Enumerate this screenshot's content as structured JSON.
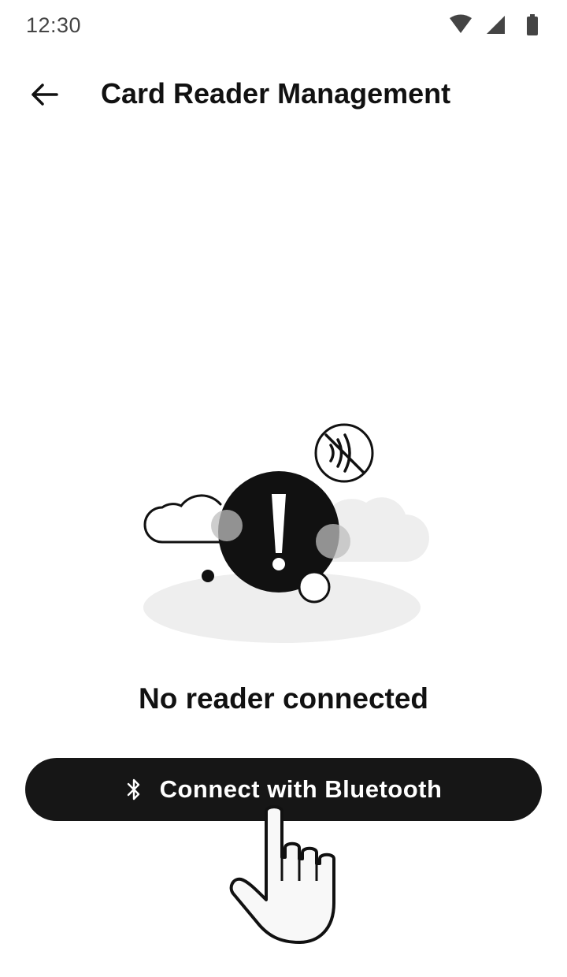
{
  "status_bar": {
    "time": "12:30",
    "icons": [
      "wifi-icon",
      "cellular-signal-icon",
      "battery-icon"
    ]
  },
  "app_bar": {
    "title": "Card Reader Management",
    "back_icon": "arrow-left-icon"
  },
  "illustration": {
    "icons": [
      "warning-exclamation-icon",
      "contactless-off-icon",
      "cloud-icon"
    ]
  },
  "empty_state": {
    "title": "No reader connected"
  },
  "connect_button": {
    "label": "Connect with Bluetooth",
    "icon": "bluetooth-icon"
  },
  "colors": {
    "background": "#ffffff",
    "text": "#111111",
    "button_bg": "#161616",
    "button_text": "#ffffff",
    "status_text": "#444444",
    "illustration_gray": "#eeeeee"
  }
}
